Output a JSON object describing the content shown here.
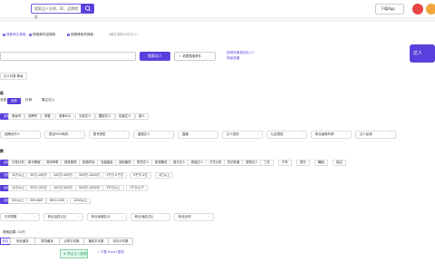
{
  "topbar": {
    "search_placeholder": "搜索达人名称、ID、品牌商家",
    "download": "下载App"
  },
  "radios": {
    "r1": "按影响力搜索",
    "r2": "按视频内容搜索",
    "r3": "按推荐相关搜索",
    "note": "(通过搜索ID定达人)"
  },
  "main_btn": "搜索达人",
  "sub_btn": "收藏搜索条件",
  "links": {
    "a": "如何快速找到达人?",
    "b": "添加收藏"
  },
  "mascot": "达人",
  "filter_tag": "达人分类:美妆",
  "sec1": {
    "title": "板",
    "tabs": [
      "全部",
      "全部",
      "抖音",
      "",
      "播主达人"
    ]
  },
  "row1": [
    "全部",
    "美妆号",
    "品牌号",
    "母婴",
    "美食KOL",
    "头部达人",
    "腰部达人",
    "初级达人",
    "素人"
  ],
  "dd1": [
    "品牌合作人",
    "是否MCN机构",
    "账号类型",
    "星图达人",
    "直播",
    "达人性别",
    "认证类型",
    "粉丝画像年龄",
    "达人区域"
  ],
  "sec2": {
    "title": "数"
  },
  "row2": [
    "全部",
    "日常分享",
    "新手教程",
    "测评种草",
    "搞笑剧情",
    "颜值时尚",
    "流量最高",
    "涨粉最快",
    "带货达人",
    "影视解说",
    "音乐达人",
    "颜值达人",
    "才艺分享",
    "知识科普",
    "宠物达人",
    "三农",
    "汽车",
    "旅行",
    "舞蹈",
    "探店"
  ],
  "row3": [
    "全部",
    "10万以上",
    "50万-100万",
    "100万-500万",
    "500万-1000万",
    "1千万-5千万",
    "5千万-1亿",
    "1亿以上"
  ],
  "row4": [
    "全部",
    "10万以上",
    "50万-100万",
    "100万-500万",
    "500万-1000万",
    "1千万以上",
    "1千万以下"
  ],
  "row5": [
    "全部",
    "500以上",
    "500-800",
    "800-1200",
    "1200以上"
  ],
  "dd2": [
    "平均赞数",
    "粉丝活跃占比",
    "粉丝地域区分",
    "粉丝消费占比",
    "粉丝比例"
  ],
  "tabs2": [
    "综合",
    "粉丝最多",
    "带货最多",
    "点赞平均数",
    "播放平均数",
    "评论平均数"
  ],
  "footer": {
    "count": "搜索结果: 10万",
    "add": "导出达人数据",
    "dl": "下载 Excel 报表"
  }
}
